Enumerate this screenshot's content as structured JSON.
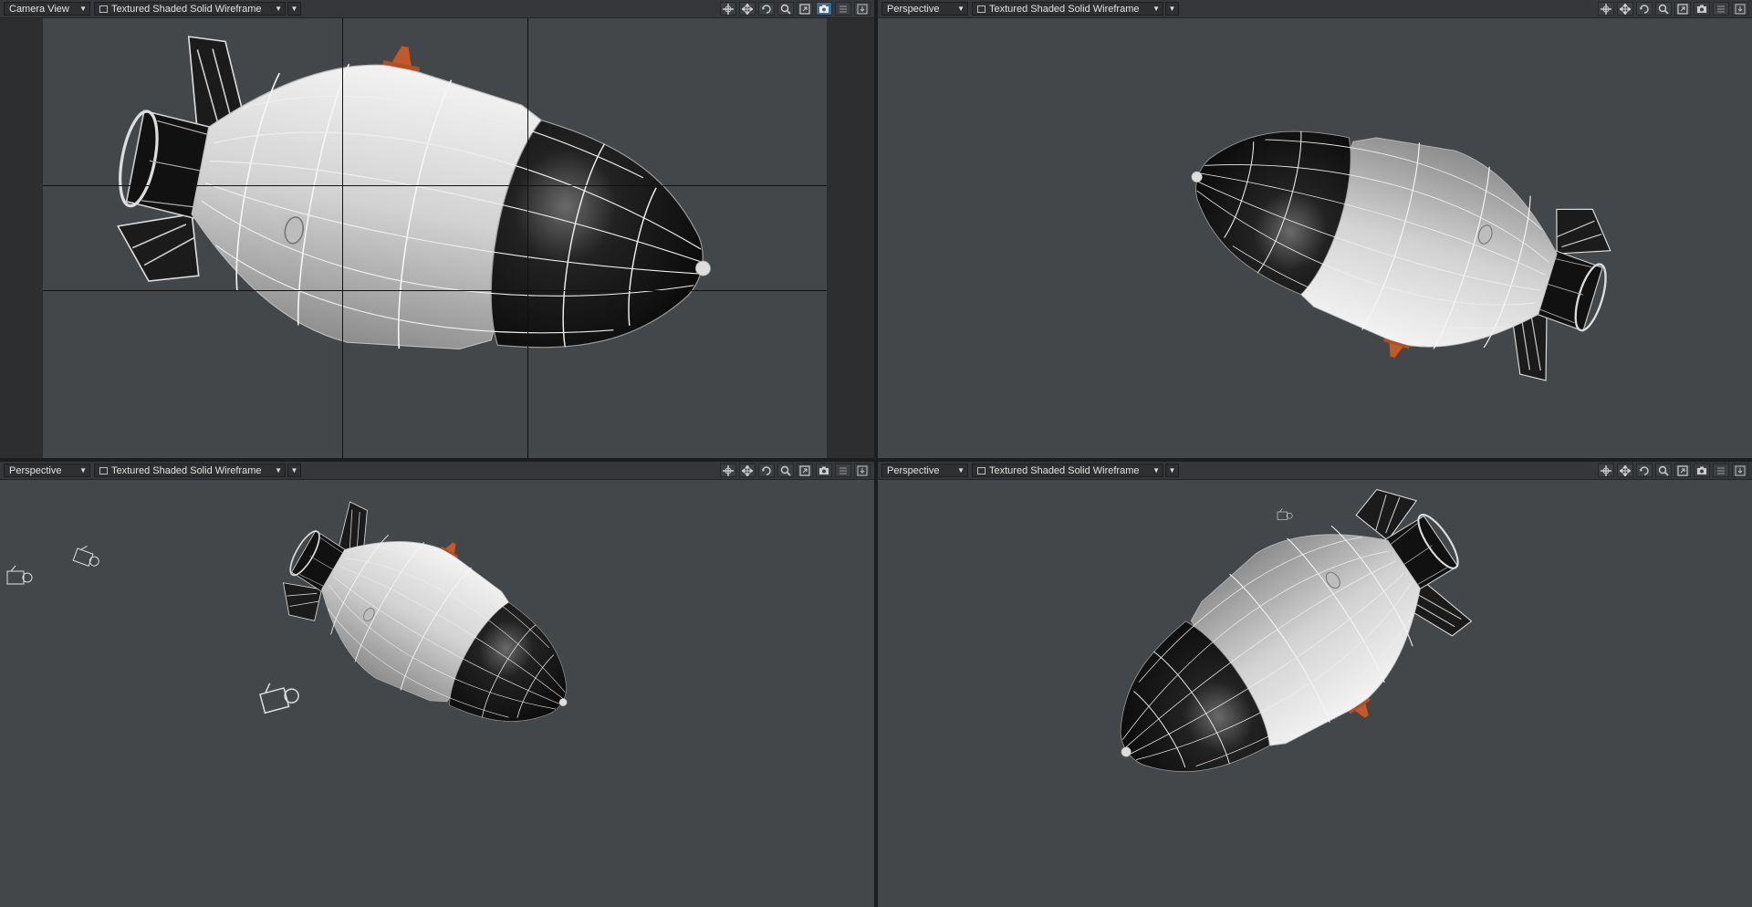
{
  "viewports": [
    {
      "view": "Camera View",
      "mode": "Textured Shaded Solid Wireframe"
    },
    {
      "view": "Perspective",
      "mode": "Textured Shaded Solid Wireframe"
    },
    {
      "view": "Perspective",
      "mode": "Textured Shaded Solid Wireframe"
    },
    {
      "view": "Perspective",
      "mode": "Textured Shaded Solid Wireframe"
    }
  ],
  "toolbar_icons": [
    "move-icon",
    "pan-icon",
    "rotate-icon",
    "zoom-icon",
    "maximize-icon",
    "camera-icon",
    "list-icon",
    "download-icon"
  ],
  "colors": {
    "viewport_bg": "#44474a",
    "body_white": "#d9d9d9",
    "nose_black": "#161616",
    "detail_orange": "#c05a2c",
    "active_button": "#3b6c93"
  }
}
